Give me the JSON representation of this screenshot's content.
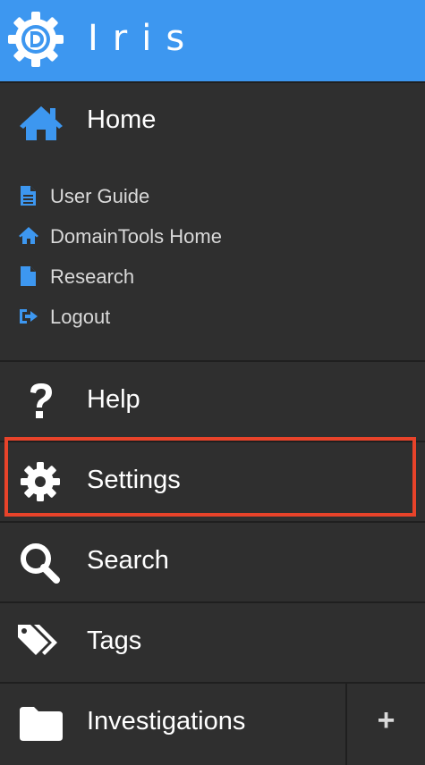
{
  "app": {
    "title": "Iris",
    "accent_color": "#3d97f0",
    "highlight_color": "#e8432a"
  },
  "header": {
    "logo_icon": "gear-d-logo-icon",
    "title": "Iris"
  },
  "nav": {
    "home": {
      "label": "Home",
      "icon": "home-icon"
    },
    "sublinks": [
      {
        "label": "User Guide",
        "icon": "document-icon"
      },
      {
        "label": "DomainTools Home",
        "icon": "home-icon"
      },
      {
        "label": "Research",
        "icon": "file-icon"
      },
      {
        "label": "Logout",
        "icon": "logout-icon"
      }
    ],
    "help": {
      "label": "Help",
      "icon": "question-icon"
    },
    "settings": {
      "label": "Settings",
      "icon": "gear-icon",
      "highlighted": true
    },
    "search": {
      "label": "Search",
      "icon": "search-icon"
    },
    "tags": {
      "label": "Tags",
      "icon": "tags-icon"
    },
    "investigations": {
      "label": "Investigations",
      "icon": "folder-icon",
      "add_label": "+"
    }
  }
}
